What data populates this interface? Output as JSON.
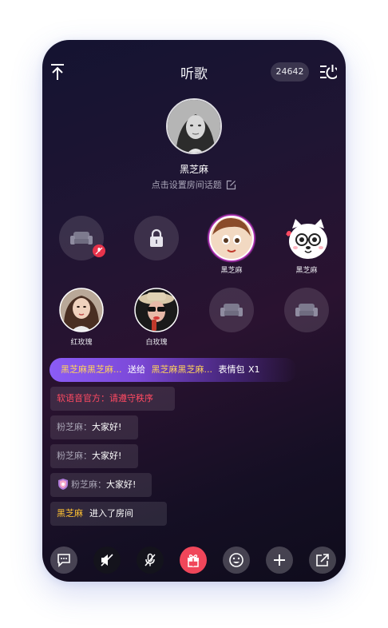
{
  "header": {
    "title": "听歌",
    "online_count": "24642",
    "icons": [
      "minimize-up-icon",
      "exit-power-icon"
    ]
  },
  "host": {
    "name": "黑芝麻",
    "topic_prompt": "点击设置房间话题"
  },
  "seats_row1": [
    {
      "state": "empty-muted",
      "label": ""
    },
    {
      "state": "locked",
      "label": ""
    },
    {
      "state": "occupied",
      "label": "黑芝麻"
    },
    {
      "state": "occupied",
      "label": "黑芝麻"
    }
  ],
  "seats_row2": [
    {
      "state": "occupied",
      "label": "红玫瑰"
    },
    {
      "state": "occupied",
      "label": "白玫瑰"
    },
    {
      "state": "empty",
      "label": ""
    },
    {
      "state": "empty",
      "label": ""
    }
  ],
  "gift_banner": {
    "sender": "黑芝麻黑芝麻...",
    "verb": "送给",
    "receiver": "黑芝麻黑芝麻...",
    "gift": "表情包",
    "count": "X1"
  },
  "messages": [
    {
      "name": "软语音官方：",
      "text": "请遵守秩序"
    },
    {
      "name": "粉芝麻：",
      "text": "大家好!"
    },
    {
      "name": "粉芝麻：",
      "text": "大家好!"
    },
    {
      "name": "粉芝麻：",
      "text": "大家好!"
    },
    {
      "name": "黑芝麻",
      "text": "进入了房间"
    }
  ],
  "toolbar": {
    "buttons": [
      "chat-icon",
      "speaker-mute-icon",
      "mic-mute-icon",
      "gift-icon",
      "emoji-icon",
      "plus-icon",
      "share-icon"
    ]
  },
  "colors": {
    "accent_gold": "#ffd35a",
    "official_red": "#ff4a62",
    "gift_button": "#f0465a",
    "gift_banner": "#8b5cf6"
  }
}
